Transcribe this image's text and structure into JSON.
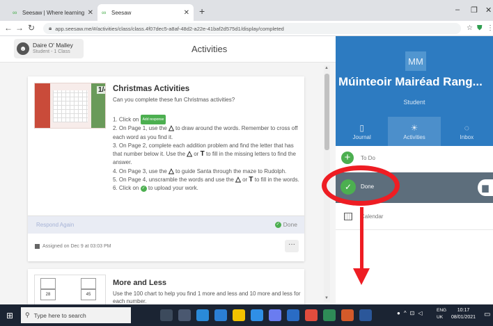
{
  "browser": {
    "tabs": [
      {
        "title": "Seesaw | Where learning happen",
        "active": false
      },
      {
        "title": "Seesaw",
        "active": true
      }
    ],
    "new_tab": "+",
    "url": "app.seesaw.me/#/activities/class/class.4f07dec5-a8af-48d2-a22e-41baf2d575d1/display/completed",
    "window_controls": {
      "minimize": "–",
      "maximize": "❐",
      "close": "✕"
    }
  },
  "header": {
    "user_name": "Daire O' Malley",
    "user_sub": "Student - 1 Class",
    "page_title": "Activities"
  },
  "activity1": {
    "title": "Christmas Activities",
    "subtitle": "Can you complete these fun Christmas activities?",
    "page_badge": "1/4",
    "steps": {
      "s1_prefix": "1. Click on",
      "s1_chip": "Add response",
      "s2_a": "2. On Page 1, use the",
      "s2_b": "to draw around the words. Remember to cross off each word as you find it.",
      "s3_a": "3. On Page 2, complete each addition problem and find the letter that has that number below it. Use the",
      "s3_or": "or",
      "s3_b": "to fill in the missing letters to find the answer.",
      "s4_a": "4. On Page 3, use the",
      "s4_b": "to guide Santa through the maze to Rudolph.",
      "s5_a": "5. On Page 4, unscramble the words and use the",
      "s5_or": "or",
      "s5_b": "to fill in the words.",
      "s6_a": "6. Click on",
      "s6_b": "to upload your work."
    },
    "respond_again": "Respond Again",
    "status": "Done",
    "assigned": "Assigned on Dec 9 at 03:03 PM",
    "more": "···"
  },
  "activity2": {
    "title": "More and Less",
    "description": "Use the 100 chart to help you find 1 more and less and 10 more and less for each number.",
    "thumb_values": [
      "28",
      "45"
    ]
  },
  "sidebar": {
    "initials": "MM",
    "teacher_name": "Múinteoir Mairéad Rang...",
    "role": "Student",
    "tabs": [
      {
        "label": "Journal",
        "selected": false
      },
      {
        "label": "Activities",
        "selected": true
      },
      {
        "label": "Inbox",
        "selected": false
      }
    ],
    "filters": {
      "todo": "To Do",
      "done": "Done",
      "calendar": "Calendar"
    }
  },
  "taskbar": {
    "search_placeholder": "Type here to search",
    "lang_line1": "ENG",
    "lang_line2": "UK",
    "time": "10:17",
    "date": "08/01/2021"
  },
  "colors": {
    "brand_blue": "#2d7bc1",
    "done_row": "#5d6e7c",
    "success_green": "#4caf50",
    "annotation_red": "#ee1d23"
  }
}
